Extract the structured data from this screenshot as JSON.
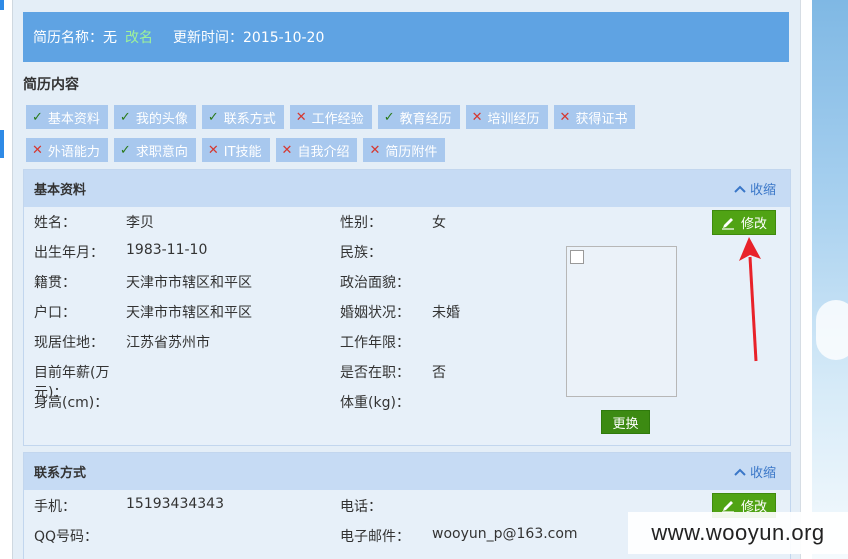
{
  "header": {
    "resume_name_label": "简历名称：无",
    "rename_link": "改名",
    "update_time": "更新时间：2015-10-20"
  },
  "content_title": "简历内容",
  "tags_row1": [
    {
      "label": "基本资料",
      "status": "done"
    },
    {
      "label": "我的头像",
      "status": "done"
    },
    {
      "label": "联系方式",
      "status": "done"
    },
    {
      "label": "工作经验",
      "status": "missing"
    },
    {
      "label": "教育经历",
      "status": "done"
    },
    {
      "label": "培训经历",
      "status": "missing"
    },
    {
      "label": "获得证书",
      "status": "missing"
    }
  ],
  "tags_row2": [
    {
      "label": "外语能力",
      "status": "missing"
    },
    {
      "label": "求职意向",
      "status": "done"
    },
    {
      "label": "IT技能",
      "status": "missing"
    },
    {
      "label": "自我介绍",
      "status": "missing"
    },
    {
      "label": "简历附件",
      "status": "missing"
    }
  ],
  "basic": {
    "title": "基本资料",
    "collapse": "收缩",
    "edit": "修改",
    "change_photo": "更换",
    "fields_left": [
      {
        "label": "姓名：",
        "value": "李贝"
      },
      {
        "label": "出生年月：",
        "value": "1983-11-10"
      },
      {
        "label": "籍贯：",
        "value": "天津市市辖区和平区"
      },
      {
        "label": "户口：",
        "value": "天津市市辖区和平区"
      },
      {
        "label": "现居住地：",
        "value": "江苏省苏州市"
      },
      {
        "label": "目前年薪(万元)：",
        "value": ""
      },
      {
        "label": "身高(cm)：",
        "value": ""
      }
    ],
    "fields_right": [
      {
        "label": "性别：",
        "value": "女"
      },
      {
        "label": "民族：",
        "value": ""
      },
      {
        "label": "政治面貌：",
        "value": ""
      },
      {
        "label": "婚姻状况：",
        "value": "未婚"
      },
      {
        "label": "工作年限：",
        "value": ""
      },
      {
        "label": "是否在职：",
        "value": "否"
      },
      {
        "label": "体重(kg)：",
        "value": ""
      }
    ]
  },
  "contact": {
    "title": "联系方式",
    "collapse": "收缩",
    "edit": "修改",
    "fields_left": [
      {
        "label": "手机：",
        "value": "15193434343"
      },
      {
        "label": "QQ号码：",
        "value": ""
      }
    ],
    "fields_right": [
      {
        "label": "电话：",
        "value": ""
      },
      {
        "label": "电子邮件：",
        "value": "wooyun_p@163.com"
      }
    ]
  },
  "watermark": "www.wooyun.org",
  "colors": {
    "ok": "#2a7a1a",
    "missing": "#d6372f",
    "arrow": "#e8222a"
  }
}
